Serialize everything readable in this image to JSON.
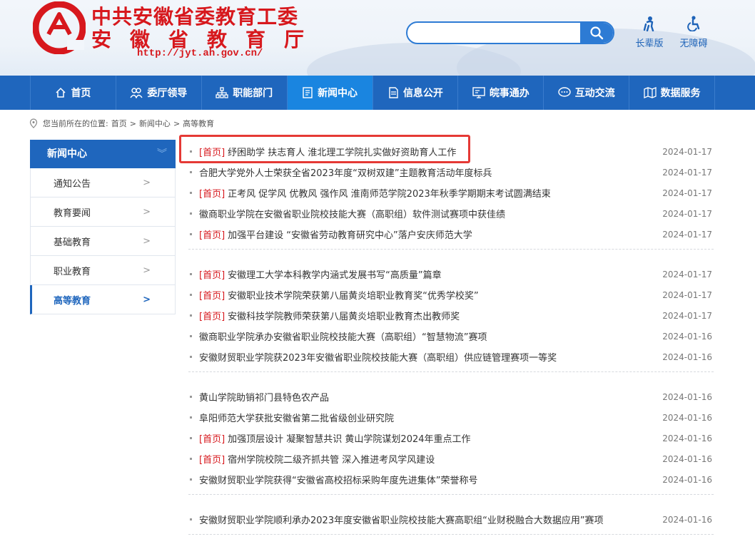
{
  "header": {
    "logo_line1": "中共安徽省委教育工委",
    "logo_line2": "安徽省教育厅",
    "logo_url": "http://jyt.ah.gov.cn/",
    "search": {
      "value": "",
      "placeholder": ""
    },
    "tools": [
      {
        "label": "长辈版",
        "icon": "elder-icon"
      },
      {
        "label": "无障碍",
        "icon": "accessibility-icon"
      }
    ]
  },
  "nav": [
    {
      "label": "首页",
      "icon": "home-icon"
    },
    {
      "label": "委厅领导",
      "icon": "leaders-icon"
    },
    {
      "label": "职能部门",
      "icon": "org-chart-icon"
    },
    {
      "label": "新闻中心",
      "icon": "news-icon",
      "active": true
    },
    {
      "label": "信息公开",
      "icon": "document-icon"
    },
    {
      "label": "皖事通办",
      "icon": "monitor-icon"
    },
    {
      "label": "互动交流",
      "icon": "chat-icon"
    },
    {
      "label": "数据服务",
      "icon": "map-icon"
    }
  ],
  "breadcrumb": {
    "prefix": "您当前所在的位置:",
    "items": [
      "首页",
      "新闻中心",
      "高等教育"
    ],
    "sep": ">"
  },
  "sidebar": {
    "title": "新闻中心",
    "items": [
      {
        "label": "通知公告"
      },
      {
        "label": "教育要闻"
      },
      {
        "label": "基础教育"
      },
      {
        "label": "职业教育"
      },
      {
        "label": "高等教育",
        "active": true
      }
    ]
  },
  "news": {
    "groups": [
      [
        {
          "tag": "[首页]",
          "title": "纾困助学 扶志育人 淮北理工学院扎实做好资助育人工作",
          "date": "2024-01-17"
        },
        {
          "tag": "",
          "title": "合肥大学党外人士荣获全省2023年度“双树双建”主题教育活动年度标兵",
          "date": "2024-01-17"
        },
        {
          "tag": "[首页]",
          "title": "正考风 促学风 优教风 强作风 淮南师范学院2023年秋季学期期末考试圆满结束",
          "date": "2024-01-17"
        },
        {
          "tag": "",
          "title": "徽商职业学院在安徽省职业院校技能大赛（高职组）软件测试赛项中获佳绩",
          "date": "2024-01-17"
        },
        {
          "tag": "[首页]",
          "title": "加强平台建设 “安徽省劳动教育研究中心”落户安庆师范大学",
          "date": "2024-01-17"
        }
      ],
      [
        {
          "tag": "[首页]",
          "title": "安徽理工大学本科教学内涵式发展书写“高质量”篇章",
          "date": "2024-01-17"
        },
        {
          "tag": "[首页]",
          "title": "安徽职业技术学院荣获第八届黄炎培职业教育奖“优秀学校奖”",
          "date": "2024-01-17"
        },
        {
          "tag": "[首页]",
          "title": "安徽科技学院教师荣获第八届黄炎培职业教育杰出教师奖",
          "date": "2024-01-17"
        },
        {
          "tag": "",
          "title": "徽商职业学院承办安徽省职业院校技能大赛（高职组）“智慧物流”赛项",
          "date": "2024-01-16"
        },
        {
          "tag": "",
          "title": "安徽财贸职业学院获2023年安徽省职业院校技能大赛（高职组）供应链管理赛项一等奖",
          "date": "2024-01-16"
        }
      ],
      [
        {
          "tag": "",
          "title": "黄山学院助销祁门县特色农产品",
          "date": "2024-01-16"
        },
        {
          "tag": "",
          "title": "阜阳师范大学获批安徽省第二批省级创业研究院",
          "date": "2024-01-16"
        },
        {
          "tag": "[首页]",
          "title": "加强顶层设计 凝聚智慧共识 黄山学院谋划2024年重点工作",
          "date": "2024-01-16"
        },
        {
          "tag": "[首页]",
          "title": "宿州学院校院二级齐抓共管 深入推进考风学风建设",
          "date": "2024-01-16"
        },
        {
          "tag": "",
          "title": "安徽财贸职业学院获得“安徽省高校招标采购年度先进集体”荣誉称号",
          "date": "2024-01-16"
        }
      ],
      [
        {
          "tag": "",
          "title": "安徽财贸职业学院顺利承办2023年度安徽省职业院校技能大赛高职组“业财税融合大数据应用”赛项",
          "date": "2024-01-16"
        }
      ]
    ]
  },
  "colors": {
    "brand_red": "#d7181d",
    "nav_blue": "#1f66bd",
    "nav_active": "#1a85e0",
    "highlight": "#e53935"
  }
}
